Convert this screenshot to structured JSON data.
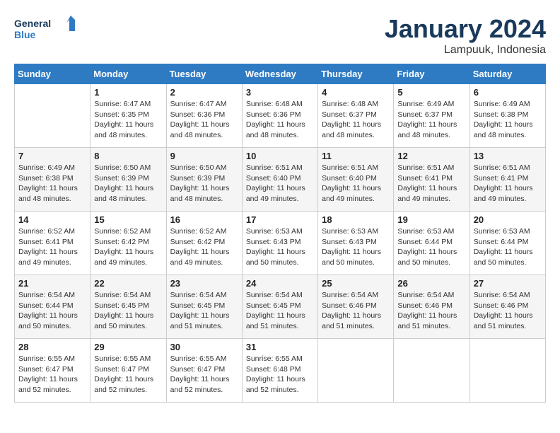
{
  "header": {
    "logo_line1": "General",
    "logo_line2": "Blue",
    "title": "January 2024",
    "subtitle": "Lampuuk, Indonesia"
  },
  "days_of_week": [
    "Sunday",
    "Monday",
    "Tuesday",
    "Wednesday",
    "Thursday",
    "Friday",
    "Saturday"
  ],
  "weeks": [
    [
      {
        "day": "",
        "info": ""
      },
      {
        "day": "1",
        "info": "Sunrise: 6:47 AM\nSunset: 6:35 PM\nDaylight: 11 hours and 48 minutes."
      },
      {
        "day": "2",
        "info": "Sunrise: 6:47 AM\nSunset: 6:36 PM\nDaylight: 11 hours and 48 minutes."
      },
      {
        "day": "3",
        "info": "Sunrise: 6:48 AM\nSunset: 6:36 PM\nDaylight: 11 hours and 48 minutes."
      },
      {
        "day": "4",
        "info": "Sunrise: 6:48 AM\nSunset: 6:37 PM\nDaylight: 11 hours and 48 minutes."
      },
      {
        "day": "5",
        "info": "Sunrise: 6:49 AM\nSunset: 6:37 PM\nDaylight: 11 hours and 48 minutes."
      },
      {
        "day": "6",
        "info": "Sunrise: 6:49 AM\nSunset: 6:38 PM\nDaylight: 11 hours and 48 minutes."
      }
    ],
    [
      {
        "day": "7",
        "info": "Sunrise: 6:49 AM\nSunset: 6:38 PM\nDaylight: 11 hours and 48 minutes."
      },
      {
        "day": "8",
        "info": "Sunrise: 6:50 AM\nSunset: 6:39 PM\nDaylight: 11 hours and 48 minutes."
      },
      {
        "day": "9",
        "info": "Sunrise: 6:50 AM\nSunset: 6:39 PM\nDaylight: 11 hours and 48 minutes."
      },
      {
        "day": "10",
        "info": "Sunrise: 6:51 AM\nSunset: 6:40 PM\nDaylight: 11 hours and 49 minutes."
      },
      {
        "day": "11",
        "info": "Sunrise: 6:51 AM\nSunset: 6:40 PM\nDaylight: 11 hours and 49 minutes."
      },
      {
        "day": "12",
        "info": "Sunrise: 6:51 AM\nSunset: 6:41 PM\nDaylight: 11 hours and 49 minutes."
      },
      {
        "day": "13",
        "info": "Sunrise: 6:51 AM\nSunset: 6:41 PM\nDaylight: 11 hours and 49 minutes."
      }
    ],
    [
      {
        "day": "14",
        "info": "Sunrise: 6:52 AM\nSunset: 6:41 PM\nDaylight: 11 hours and 49 minutes."
      },
      {
        "day": "15",
        "info": "Sunrise: 6:52 AM\nSunset: 6:42 PM\nDaylight: 11 hours and 49 minutes."
      },
      {
        "day": "16",
        "info": "Sunrise: 6:52 AM\nSunset: 6:42 PM\nDaylight: 11 hours and 49 minutes."
      },
      {
        "day": "17",
        "info": "Sunrise: 6:53 AM\nSunset: 6:43 PM\nDaylight: 11 hours and 50 minutes."
      },
      {
        "day": "18",
        "info": "Sunrise: 6:53 AM\nSunset: 6:43 PM\nDaylight: 11 hours and 50 minutes."
      },
      {
        "day": "19",
        "info": "Sunrise: 6:53 AM\nSunset: 6:44 PM\nDaylight: 11 hours and 50 minutes."
      },
      {
        "day": "20",
        "info": "Sunrise: 6:53 AM\nSunset: 6:44 PM\nDaylight: 11 hours and 50 minutes."
      }
    ],
    [
      {
        "day": "21",
        "info": "Sunrise: 6:54 AM\nSunset: 6:44 PM\nDaylight: 11 hours and 50 minutes."
      },
      {
        "day": "22",
        "info": "Sunrise: 6:54 AM\nSunset: 6:45 PM\nDaylight: 11 hours and 50 minutes."
      },
      {
        "day": "23",
        "info": "Sunrise: 6:54 AM\nSunset: 6:45 PM\nDaylight: 11 hours and 51 minutes."
      },
      {
        "day": "24",
        "info": "Sunrise: 6:54 AM\nSunset: 6:45 PM\nDaylight: 11 hours and 51 minutes."
      },
      {
        "day": "25",
        "info": "Sunrise: 6:54 AM\nSunset: 6:46 PM\nDaylight: 11 hours and 51 minutes."
      },
      {
        "day": "26",
        "info": "Sunrise: 6:54 AM\nSunset: 6:46 PM\nDaylight: 11 hours and 51 minutes."
      },
      {
        "day": "27",
        "info": "Sunrise: 6:54 AM\nSunset: 6:46 PM\nDaylight: 11 hours and 51 minutes."
      }
    ],
    [
      {
        "day": "28",
        "info": "Sunrise: 6:55 AM\nSunset: 6:47 PM\nDaylight: 11 hours and 52 minutes."
      },
      {
        "day": "29",
        "info": "Sunrise: 6:55 AM\nSunset: 6:47 PM\nDaylight: 11 hours and 52 minutes."
      },
      {
        "day": "30",
        "info": "Sunrise: 6:55 AM\nSunset: 6:47 PM\nDaylight: 11 hours and 52 minutes."
      },
      {
        "day": "31",
        "info": "Sunrise: 6:55 AM\nSunset: 6:48 PM\nDaylight: 11 hours and 52 minutes."
      },
      {
        "day": "",
        "info": ""
      },
      {
        "day": "",
        "info": ""
      },
      {
        "day": "",
        "info": ""
      }
    ]
  ]
}
